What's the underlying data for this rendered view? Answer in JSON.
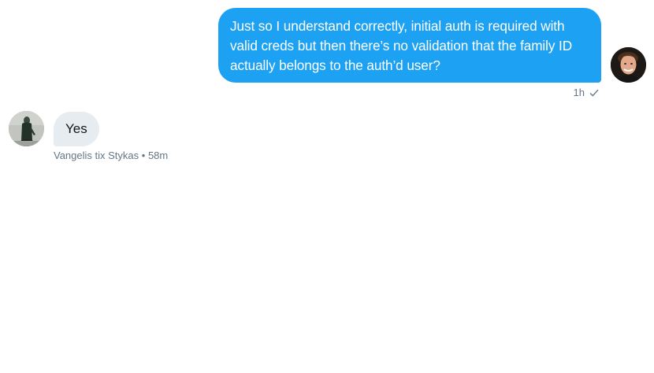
{
  "messages": {
    "outgoing": {
      "text": "Just so I understand correctly, initial auth is required with valid creds but then there’s no validation that the family ID actually belongs to the auth’d user?",
      "time": "1h",
      "status_icon": "check-icon",
      "avatar_icon": "user-avatar"
    },
    "incoming": {
      "text": "Yes",
      "sender": "Vangelis tix Stykas",
      "separator": "•",
      "time": "58m",
      "avatar_icon": "contact-avatar"
    }
  },
  "colors": {
    "outgoing_bubble": "#1da1f2",
    "incoming_bubble": "#e6ecf0",
    "meta_text": "#657786"
  }
}
